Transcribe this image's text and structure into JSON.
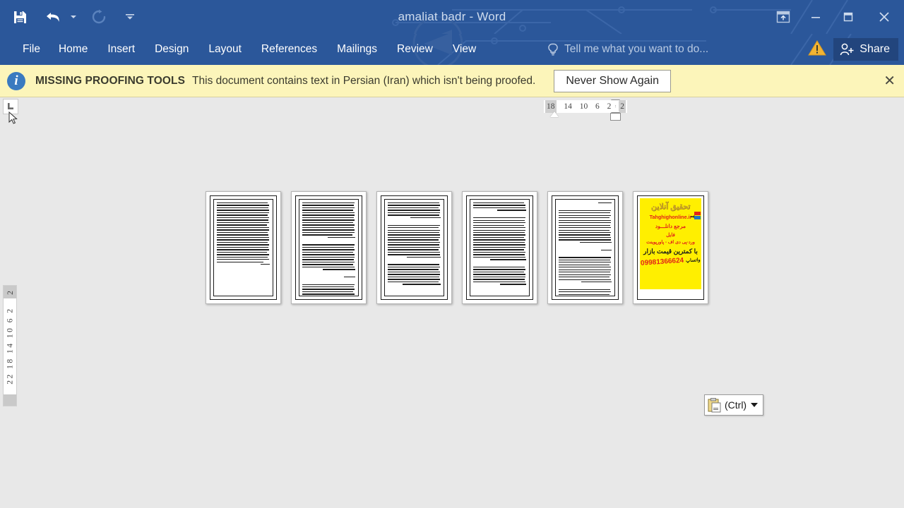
{
  "titlebar": {
    "document_title": "amaliat badr - Word",
    "quick_access": [
      {
        "name": "save",
        "label": "Save",
        "icon": "save-icon"
      },
      {
        "name": "undo",
        "label": "Undo",
        "icon": "undo-icon"
      },
      {
        "name": "redo",
        "label": "Repeat",
        "icon": "redo-icon"
      },
      {
        "name": "customize",
        "label": "Customize Quick Access Toolbar",
        "icon": "chevron-down-icon"
      }
    ],
    "window_controls": [
      {
        "name": "ribbon-display-options",
        "label": "Ribbon Display Options",
        "icon": "ribbon-display-icon"
      },
      {
        "name": "minimize",
        "label": "Minimize",
        "icon": "minimize-icon"
      },
      {
        "name": "restore",
        "label": "Restore Down",
        "icon": "restore-icon"
      },
      {
        "name": "close",
        "label": "Close",
        "icon": "close-icon"
      }
    ],
    "accent_color": "#2b579a"
  },
  "ribbon": {
    "tabs": [
      {
        "label": "File"
      },
      {
        "label": "Home"
      },
      {
        "label": "Insert"
      },
      {
        "label": "Design"
      },
      {
        "label": "Layout"
      },
      {
        "label": "References"
      },
      {
        "label": "Mailings"
      },
      {
        "label": "Review"
      },
      {
        "label": "View"
      }
    ],
    "tell_me_placeholder": "Tell me what you want to do...",
    "warning_icon": "warning-triangle-icon",
    "share_label": "Share"
  },
  "message_bar": {
    "icon": "info-icon",
    "title": "MISSING PROOFING TOOLS",
    "text": "This document contains text in Persian (Iran) which isn't being proofed.",
    "button_label": "Never Show Again",
    "close_label": "✕",
    "background": "#fcf5ba"
  },
  "rulers": {
    "tab_selector_glyph": "L",
    "horizontal_ticks": [
      "18",
      "14",
      "10",
      "6",
      "2",
      "2"
    ],
    "vertical_top_tick": "2",
    "vertical_ticks": "22 18 14 10 6  2"
  },
  "document": {
    "zoom_note": "",
    "pages": [
      {
        "number": "1",
        "type": "text",
        "blocks": [
          {
            "lines": 26
          }
        ]
      },
      {
        "number": "2",
        "type": "text",
        "blocks": [
          {
            "lines": 15
          },
          {
            "lines": 11
          },
          {
            "lines": 1
          },
          {
            "lines": 6
          }
        ]
      },
      {
        "number": "3",
        "type": "text",
        "blocks": [
          {
            "lines": 7
          },
          {
            "lines": 14
          },
          {
            "lines": 10
          }
        ]
      },
      {
        "number": "4",
        "type": "text",
        "blocks": [
          {
            "lines": 4
          },
          {
            "lines": 18
          },
          {
            "lines": 9
          }
        ]
      },
      {
        "number": "5",
        "type": "text",
        "blocks": [
          {
            "lines": 1
          },
          {
            "lines": 14
          },
          {
            "lines": 1
          },
          {
            "lines": 12
          },
          {
            "lines": 5
          }
        ]
      },
      {
        "number": "6",
        "type": "advertisement"
      }
    ],
    "advertisement": {
      "logo": "تحقیق آنلاین",
      "website": "Tahghighonline.ir",
      "line_reference": "مرجع دانلـــود",
      "line_file": "فایل",
      "line_formats": "ورد-پی دی اف - پاورپوینت",
      "line_price": "با کمترین قیمت بازار",
      "phone": "09981366624",
      "whatsapp": "واتساپ",
      "background": "#ffef00",
      "accent": "#e2231a"
    }
  },
  "paste_options": {
    "icon": "clipboard-icon",
    "label": "(Ctrl)",
    "caret": "chevron-down-icon"
  }
}
